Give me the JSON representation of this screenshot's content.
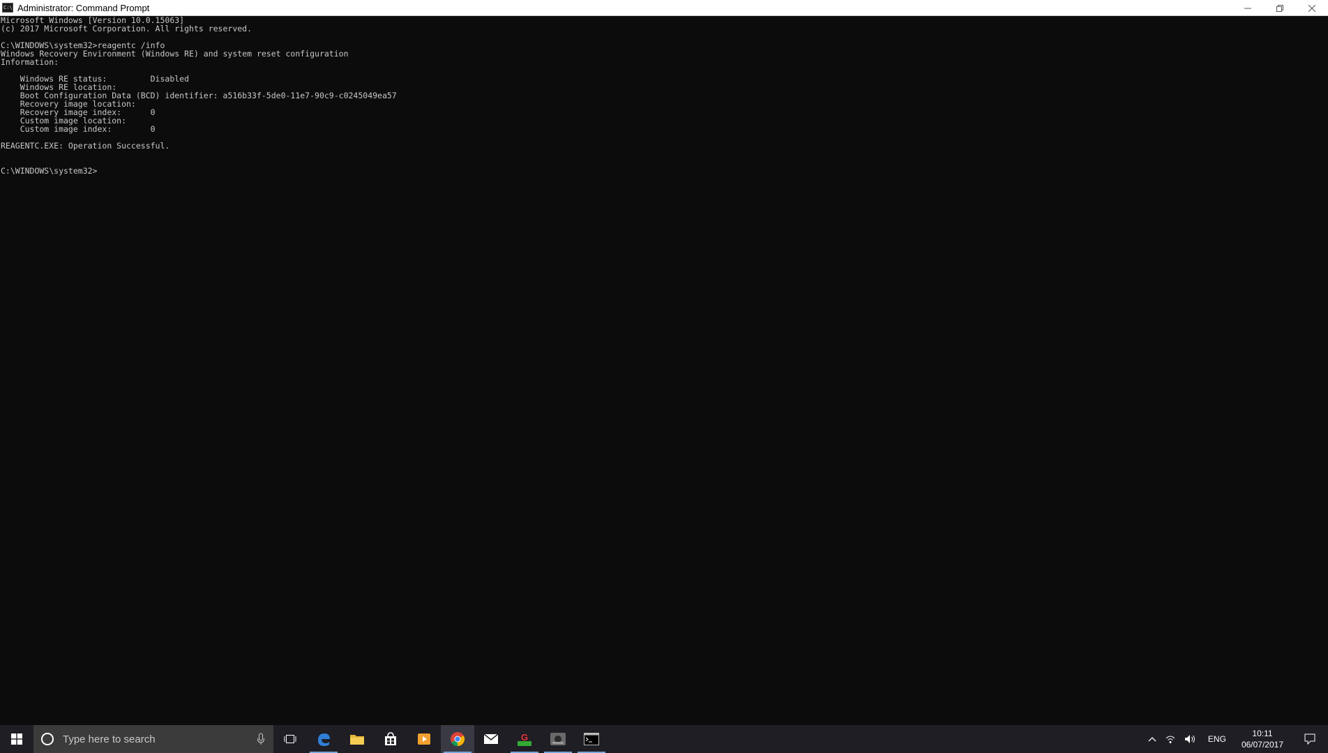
{
  "window": {
    "title": "Administrator: Command Prompt",
    "icon": "cmd-icon"
  },
  "console": {
    "lines": [
      "Microsoft Windows [Version 10.0.15063]",
      "(c) 2017 Microsoft Corporation. All rights reserved.",
      "",
      "C:\\WINDOWS\\system32>reagentc /info",
      "Windows Recovery Environment (Windows RE) and system reset configuration",
      "Information:",
      "",
      "    Windows RE status:         Disabled",
      "    Windows RE location:",
      "    Boot Configuration Data (BCD) identifier: a516b33f-5de0-11e7-90c9-c0245049ea57",
      "    Recovery image location:",
      "    Recovery image index:      0",
      "    Custom image location:",
      "    Custom image index:        0",
      "",
      "REAGENTC.EXE: Operation Successful.",
      "",
      "",
      "C:\\WINDOWS\\system32>"
    ]
  },
  "taskbar": {
    "search_placeholder": "Type here to search",
    "apps": [
      {
        "name": "task-view-icon"
      },
      {
        "name": "edge-icon"
      },
      {
        "name": "file-explorer-icon"
      },
      {
        "name": "store-icon"
      },
      {
        "name": "media-player-icon"
      },
      {
        "name": "chrome-icon"
      },
      {
        "name": "mail-icon"
      },
      {
        "name": "gpu-z-icon"
      },
      {
        "name": "app-icon"
      },
      {
        "name": "command-prompt-icon"
      }
    ],
    "tray": {
      "language": "ENG",
      "time": "10:11",
      "date": "06/07/2017"
    }
  },
  "colors": {
    "console_bg": "#0c0c0c",
    "console_fg": "#c8c8c8",
    "taskbar_bg": "#1e1e24",
    "accent": "#7aa7d8"
  }
}
